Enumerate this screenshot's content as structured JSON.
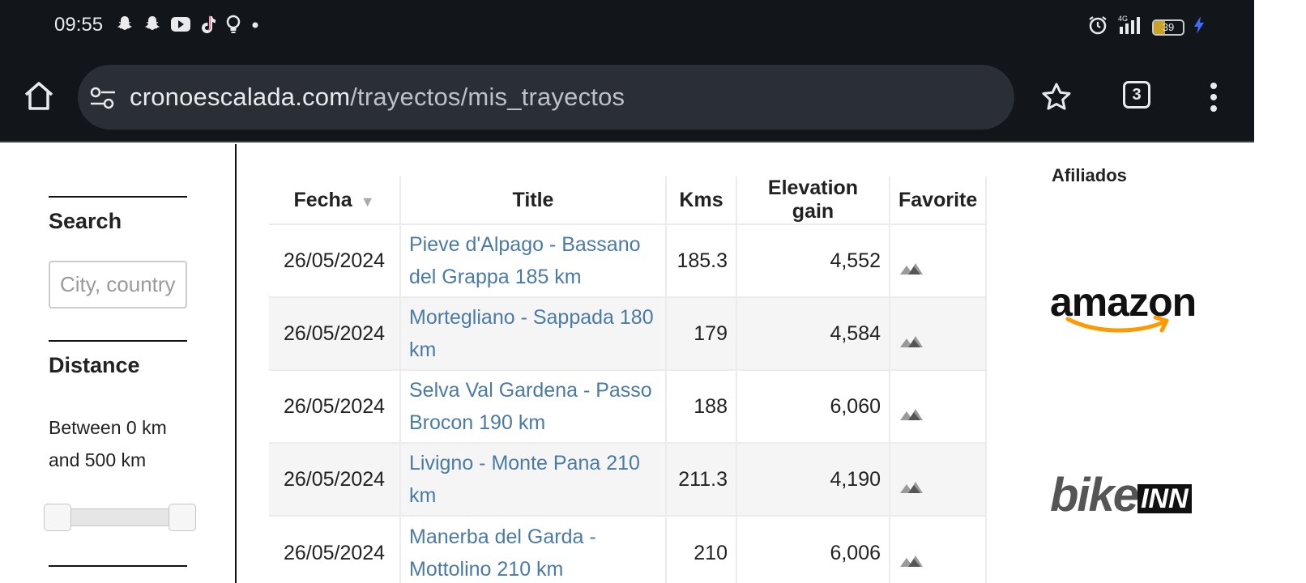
{
  "status_bar": {
    "time": "09:55",
    "left_icons": [
      "snapchat-icon",
      "snapchat-icon",
      "youtube-icon",
      "tiktok-icon",
      "lightbulb-icon",
      "dot-icon"
    ],
    "right_icons": [
      "alarm-icon",
      "signal-4g-icon",
      "battery-icon",
      "charging-icon"
    ],
    "network": "4G",
    "battery_level": "39"
  },
  "browser": {
    "url_domain": "cronoescalada.com",
    "url_path": "/trayectos/mis_trayectos",
    "tab_count": "3"
  },
  "sidebar": {
    "search_heading": "Search",
    "search_placeholder": "City, country",
    "distance_heading": "Distance",
    "distance_text": "Between 0 km and 500 km",
    "distance_min": 0,
    "distance_max": 500
  },
  "table": {
    "headers": {
      "date": "Fecha",
      "title": "Title",
      "kms": "Kms",
      "elevation": "Elevation gain",
      "favorite": "Favorite"
    },
    "sort_indicator": "▼",
    "rows": [
      {
        "date": "26/05/2024",
        "title": "Pieve d'Alpago - Bassano del Grappa 185 km",
        "kms": "185.3",
        "elevation": "4,552"
      },
      {
        "date": "26/05/2024",
        "title": "Mortegliano - Sappada 180 km",
        "kms": "179",
        "elevation": "4,584"
      },
      {
        "date": "26/05/2024",
        "title": "Selva Val Gardena - Passo Brocon 190 km",
        "kms": "188",
        "elevation": "6,060"
      },
      {
        "date": "26/05/2024",
        "title": "Livigno - Monte Pana 210 km",
        "kms": "211.3",
        "elevation": "4,190"
      },
      {
        "date": "26/05/2024",
        "title": "Manerba del Garda - Mottolino 210 km",
        "kms": "210",
        "elevation": "6,006"
      }
    ]
  },
  "affiliates": {
    "title": "Afiliados",
    "amazon_logo_text": "amazon",
    "bikeinn_logo_text_bike": "bike",
    "bikeinn_logo_text_inn": "INN"
  },
  "colors": {
    "chrome_bg": "#12161b",
    "url_bg": "#2a2f35",
    "link": "#4a7ba6",
    "amazon_orange": "#f90"
  }
}
